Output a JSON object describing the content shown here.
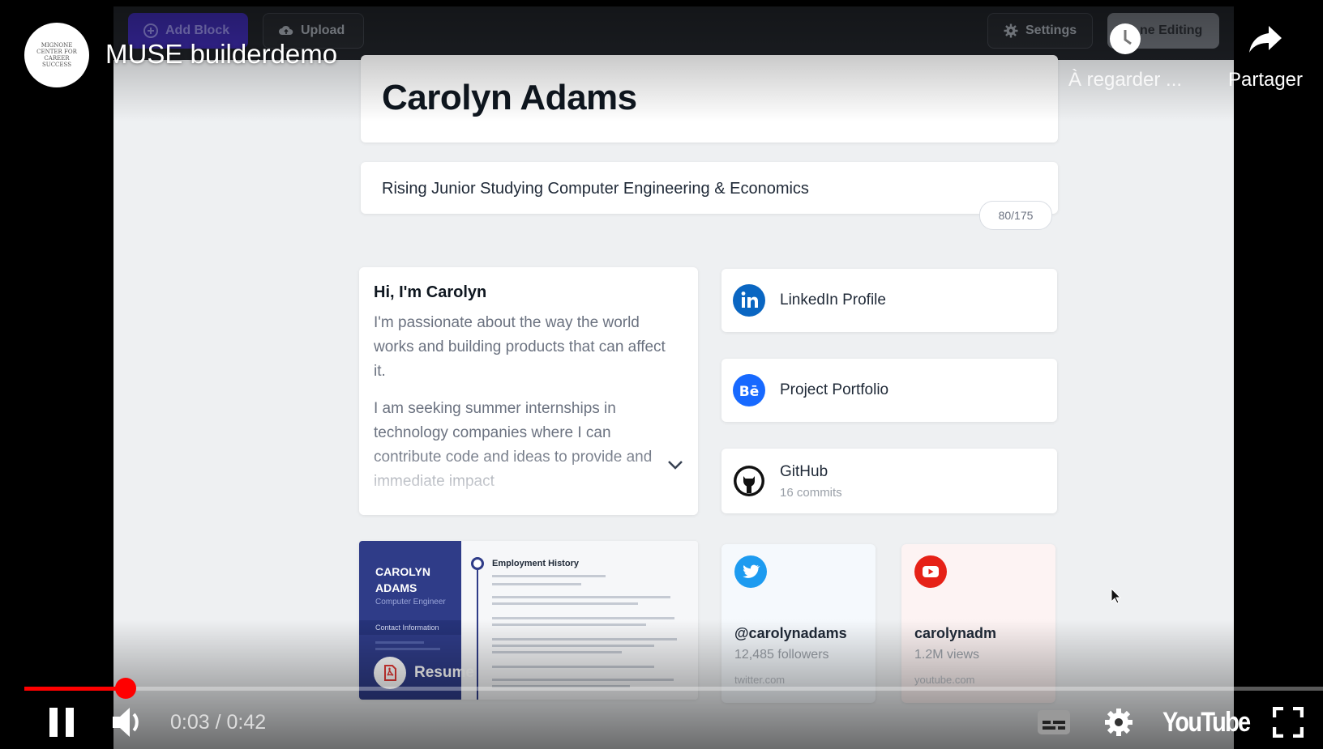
{
  "video": {
    "title": "MUSE builderdemo",
    "channel_logo_text": "MIGNONE CENTER FOR CAREER SUCCESS",
    "watch_later_label": "À regarder ...",
    "share_label": "Partager",
    "current_time": "0:03",
    "separator": " / ",
    "duration": "0:42",
    "progress_fraction": 0.078,
    "brand": "YouTube",
    "accent_color": "#ff0000"
  },
  "app_toolbar": {
    "add_block": "Add Block",
    "upload": "Upload",
    "settings": "Settings",
    "done_editing": "ne Editing"
  },
  "profile": {
    "name": "Carolyn Adams",
    "tagline": "Rising Junior Studying Computer Engineering & Economics",
    "char_counter": "80/175"
  },
  "about": {
    "heading": "Hi, I'm Carolyn",
    "paragraph1": "I'm passionate about the way the world works and building products that can affect it.",
    "paragraph2": "I am seeking summer internships in technology companies where I can contribute code and ideas to provide and immediate impact"
  },
  "links": [
    {
      "icon": "linkedin-icon",
      "label": "LinkedIn Profile",
      "color": "#0a66c2"
    },
    {
      "icon": "behance-icon",
      "label": "Project Portfolio",
      "color": "#1769ff"
    },
    {
      "icon": "github-icon",
      "label": "GitHub",
      "sub": "16 commits",
      "color": "#111111"
    }
  ],
  "resume": {
    "name_line1": "CAROLYN",
    "name_line2": "ADAMS",
    "role": "Computer Engineer",
    "contact_heading": "Contact Information",
    "section_heading": "Employment History",
    "badge_label": "Resume",
    "side_color": "#2f3c88"
  },
  "social": {
    "twitter": {
      "handle": "@carolynadams",
      "stat": "12,485 followers",
      "domain": "twitter.com",
      "color": "#1d9bf0"
    },
    "youtube": {
      "handle": "carolynadm",
      "stat": "1.2M views",
      "domain": "youtube.com",
      "color": "#ff0000"
    }
  }
}
